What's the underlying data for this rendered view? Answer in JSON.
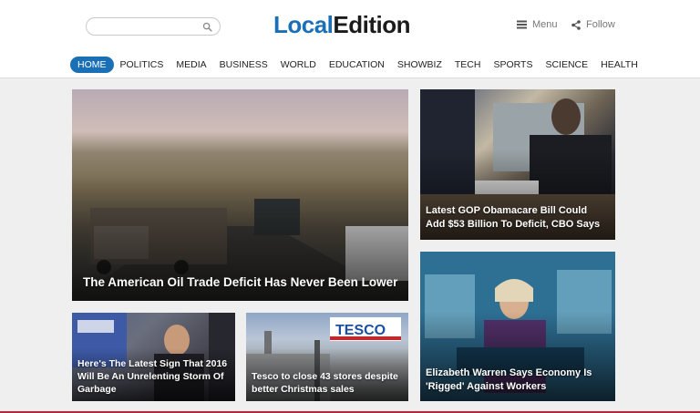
{
  "header": {
    "search": {
      "placeholder": "",
      "value": ""
    },
    "logo": {
      "part1": "Local",
      "part2": "Edition"
    },
    "menu_label": "Menu",
    "follow_label": "Follow"
  },
  "nav": {
    "items": [
      {
        "label": "HOME",
        "active": true
      },
      {
        "label": "POLITICS",
        "active": false
      },
      {
        "label": "MEDIA",
        "active": false
      },
      {
        "label": "BUSINESS",
        "active": false
      },
      {
        "label": "WORLD",
        "active": false
      },
      {
        "label": "EDUCATION",
        "active": false
      },
      {
        "label": "SHOWBIZ",
        "active": false
      },
      {
        "label": "TECH",
        "active": false
      },
      {
        "label": "SPORTS",
        "active": false
      },
      {
        "label": "SCIENCE",
        "active": false
      },
      {
        "label": "HEALTH",
        "active": false
      }
    ]
  },
  "stories": {
    "main": {
      "title": "The American Oil Trade Deficit Has Never Been Lower"
    },
    "top_right": {
      "title": "Latest GOP Obamacare Bill Could Add $53 Billion To Deficit, CBO Says"
    },
    "bottom_right": {
      "title": "Elizabeth Warren Says Economy Is 'Rigged' Against Workers"
    },
    "bottom_left": {
      "title": "Here's The Latest Sign That 2016 Will Be An Unrelenting Storm Of Garbage"
    },
    "bottom_middle": {
      "title": "Tesco to close 43 stores despite better Christmas sales"
    }
  },
  "colors": {
    "brand_blue": "#1a6fb5",
    "logo_dark": "#1b1b1b",
    "accent_red": "#c2213a",
    "page_bg": "#efefef"
  },
  "icons": {
    "search": "search-icon",
    "menu": "hamburger-menu-icon",
    "follow": "share-icon"
  }
}
